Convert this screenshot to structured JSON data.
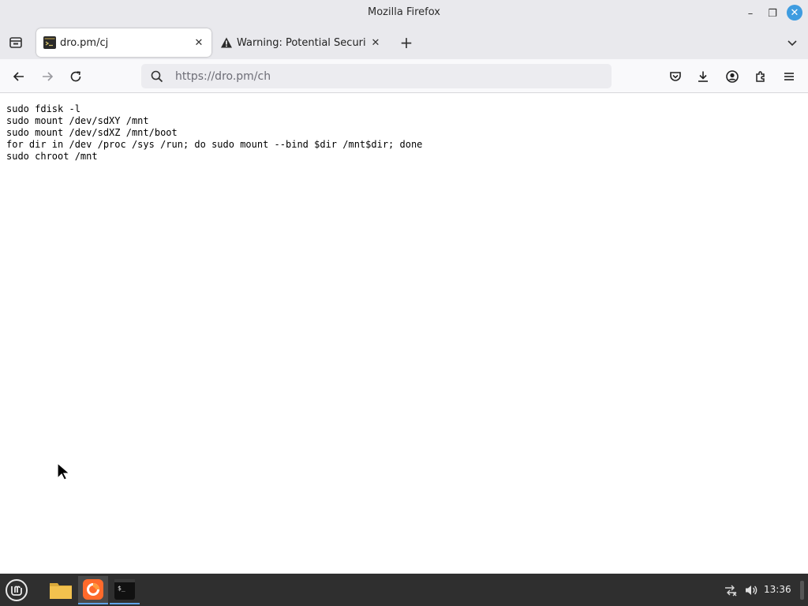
{
  "window": {
    "title": "Mozilla Firefox",
    "controls": {
      "minimize": "–",
      "maximize": "❐",
      "close": "✕"
    }
  },
  "tabs": [
    {
      "label": "dro.pm/cj",
      "active": true,
      "icon": "terminal-favicon",
      "close": "✕"
    },
    {
      "label": "Warning: Potential Security Risk Ahead",
      "active": false,
      "icon": "warning-icon",
      "close": "✕"
    }
  ],
  "toolbar": {
    "new_tab": "+",
    "url_placeholder": "https://dro.pm/ch",
    "icons": [
      "back-icon",
      "forward-icon",
      "reload-icon",
      "search-icon",
      "pocket-icon",
      "downloads-icon",
      "account-icon",
      "extensions-icon",
      "menu-icon"
    ]
  },
  "content": {
    "text": "sudo fdisk -l\nsudo mount /dev/sdXY /mnt\nsudo mount /dev/sdXZ /mnt/boot\nfor dir in /dev /proc /sys /run; do sudo mount --bind $dir /mnt$dir; done\nsudo chroot /mnt"
  },
  "taskbar": {
    "clock": "13:36",
    "items": [
      "mint-menu-icon",
      "files-icon",
      "firefox-icon",
      "terminal-icon"
    ],
    "tray": [
      "network-icon",
      "volume-icon"
    ]
  },
  "colors": {
    "chrome": "#e9e9ed",
    "accent": "#3e9ce0",
    "taskbar": "#2f2f2f"
  }
}
